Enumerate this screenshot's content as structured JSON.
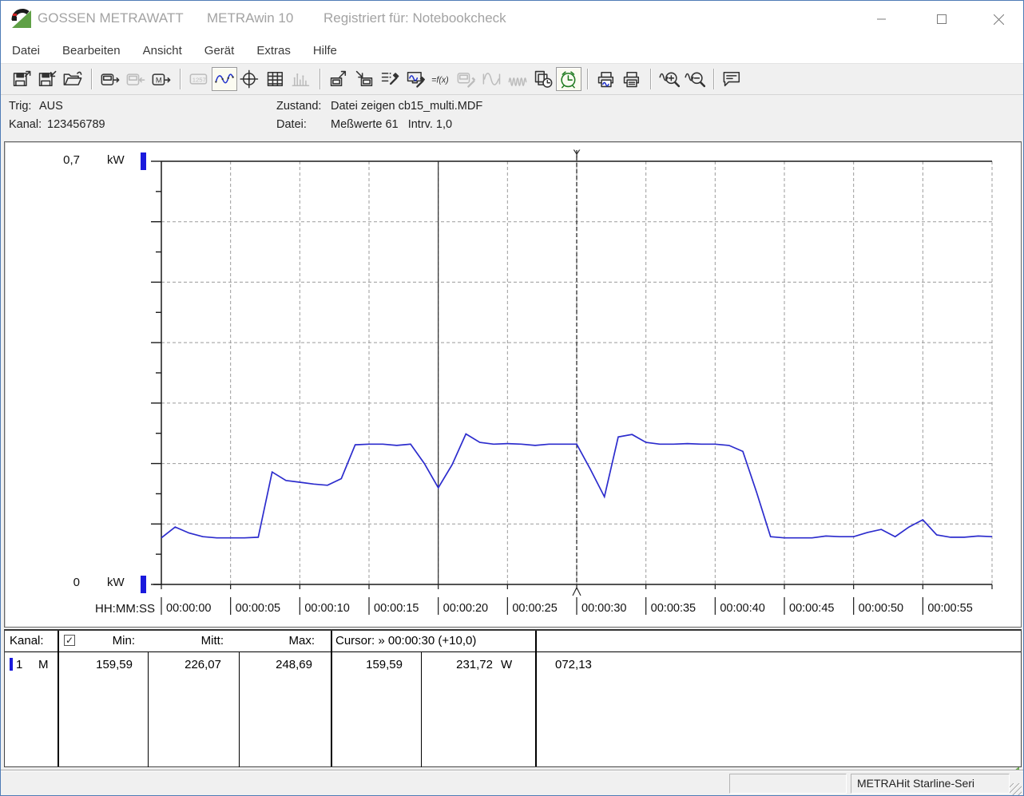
{
  "window": {
    "brand": "GOSSEN METRAWATT",
    "app": "METRAwin 10",
    "registered": "Registriert für: Notebookcheck"
  },
  "menu": {
    "items": [
      "Datei",
      "Bearbeiten",
      "Ansicht",
      "Gerät",
      "Extras",
      "Hilfe"
    ]
  },
  "toolbar": {
    "buttons": [
      {
        "name": "save-file",
        "glyph": "disk-out",
        "state": ""
      },
      {
        "name": "save-file-as",
        "glyph": "disk-in",
        "state": ""
      },
      {
        "name": "open-file",
        "glyph": "folder",
        "state": ""
      },
      {
        "name": "read-device",
        "glyph": "device-out",
        "state": "",
        "sep_before": true
      },
      {
        "name": "write-device",
        "glyph": "device-in",
        "state": "disabled"
      },
      {
        "name": "device-memory",
        "glyph": "device-m",
        "state": ""
      },
      {
        "name": "numeric-display",
        "glyph": "numeric",
        "state": "disabled",
        "sep_before": true
      },
      {
        "name": "trend-chart",
        "glyph": "trend",
        "state": "selected"
      },
      {
        "name": "xy-scope",
        "glyph": "crosshair",
        "state": ""
      },
      {
        "name": "data-table",
        "glyph": "table",
        "state": ""
      },
      {
        "name": "histogram",
        "glyph": "histogram",
        "state": "disabled"
      },
      {
        "name": "export-data",
        "glyph": "export",
        "state": "",
        "sep_before": true
      },
      {
        "name": "import-data",
        "glyph": "import",
        "state": ""
      },
      {
        "name": "channel-settings",
        "glyph": "list-tool",
        "state": ""
      },
      {
        "name": "display-settings",
        "glyph": "monitor-tool",
        "state": ""
      },
      {
        "name": "formula-fx",
        "glyph": "fx",
        "state": ""
      },
      {
        "name": "device-settings",
        "glyph": "device-tool",
        "state": "disabled"
      },
      {
        "name": "single-curve",
        "glyph": "sine",
        "state": "disabled"
      },
      {
        "name": "multi-curve",
        "glyph": "multisine",
        "state": "disabled"
      },
      {
        "name": "copy-time-window",
        "glyph": "copy-clock",
        "state": ""
      },
      {
        "name": "time-sync",
        "glyph": "green-clock",
        "state": "selected"
      },
      {
        "name": "print-preview",
        "glyph": "print-prev",
        "state": "",
        "sep_before": true
      },
      {
        "name": "print",
        "glyph": "printer",
        "state": ""
      },
      {
        "name": "zoom-in",
        "glyph": "zoom-in",
        "state": "",
        "sep_before": true
      },
      {
        "name": "zoom-out",
        "glyph": "zoom-out",
        "state": ""
      },
      {
        "name": "annotation",
        "glyph": "bubble",
        "state": "",
        "sep_before": true
      }
    ]
  },
  "info": {
    "trig_label": "Trig:",
    "trig_value": "AUS",
    "channel_label": "Kanal:",
    "channel_value": "123456789",
    "state_label": "Zustand:",
    "state_value": "Datei zeigen cb15_multi.MDF",
    "file_label": "Datei:",
    "file_value": "Meßwerte 61   Intrv. 1,0"
  },
  "chart_data": {
    "type": "line",
    "x_axis_label": "HH:MM:SS",
    "x_ticks": [
      "00:00:00",
      "00:00:05",
      "00:00:10",
      "00:00:15",
      "00:00:20",
      "00:00:25",
      "00:00:30",
      "00:00:35",
      "00:00:40",
      "00:00:45",
      "00:00:50",
      "00:00:55"
    ],
    "x_tick_interval_s": 5,
    "x_range_s": [
      0,
      60
    ],
    "y_axis": {
      "unit": "kW",
      "max_label": "0,7",
      "min_label": "0",
      "ylim": [
        0,
        0.7
      ],
      "grid_step": 0.1,
      "minor_tick": 0.05
    },
    "grid": true,
    "series": [
      {
        "name": "1",
        "unit": "W",
        "color": "#2c2ccd",
        "x_s": [
          0,
          1,
          2,
          3,
          4,
          5,
          6,
          7,
          8,
          9,
          10,
          11,
          12,
          13,
          14,
          15,
          16,
          17,
          18,
          19,
          20,
          21,
          22,
          23,
          24,
          25,
          26,
          27,
          28,
          29,
          30,
          31,
          32,
          33,
          34,
          35,
          36,
          37,
          38,
          39,
          40,
          41,
          42,
          43,
          44,
          45,
          46,
          47,
          48,
          49,
          50,
          51,
          52,
          53,
          54,
          55,
          56,
          57,
          58,
          59,
          60
        ],
        "values_w": [
          77,
          95,
          85,
          79,
          77,
          77,
          77,
          78,
          186,
          172,
          169,
          166,
          164,
          175,
          231,
          232,
          232,
          230,
          232,
          200,
          160,
          198,
          249,
          235,
          232,
          233,
          232,
          230,
          232,
          232,
          232,
          190,
          145,
          244,
          248,
          235,
          232,
          232,
          233,
          232,
          232,
          230,
          220,
          152,
          79,
          77,
          77,
          77,
          80,
          79,
          79,
          86,
          91,
          79,
          95,
          107,
          82,
          78,
          78,
          80,
          79
        ]
      }
    ],
    "cursors": [
      {
        "time": "00:00:20",
        "style": "solid"
      },
      {
        "time": "00:00:30",
        "style": "dashed",
        "marker": "Y"
      }
    ]
  },
  "stats": {
    "h_channel": "Kanal:",
    "checkbox": "✓",
    "h_min": "Min:",
    "h_mitt": "Mitt:",
    "h_max": "Max:",
    "h_cursor": "Cursor: » 00:00:30 (+10,0)",
    "ch_num": "1",
    "ch_flag": "M",
    "v_min": "159,59",
    "v_mitt": "226,07",
    "v_max": "248,69",
    "v_c1": "159,59",
    "v_c2": "231,72",
    "v_c2_unit": "W",
    "v_delta": "072,13"
  },
  "statusbar": {
    "device": "METRAHit Starline-Seri"
  }
}
